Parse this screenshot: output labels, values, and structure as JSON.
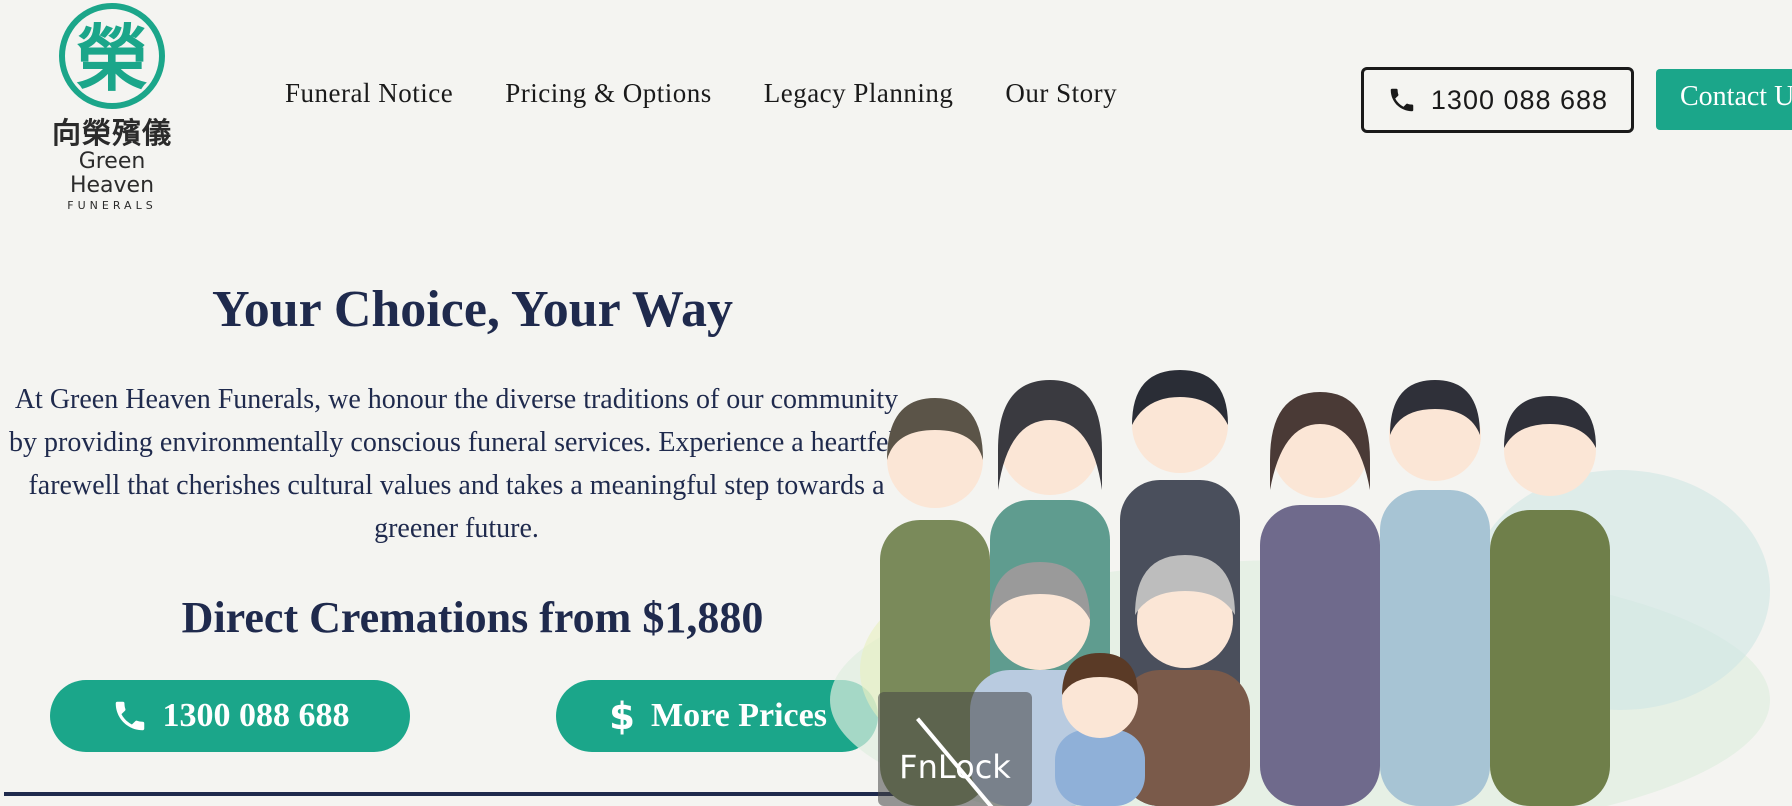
{
  "brand": {
    "name_cn": "向榮殯儀",
    "name_en": "Green Heaven",
    "subtitle": "FUNERALS",
    "logo_glyph": "榮",
    "accent": "#1ba68a",
    "navy": "#1f2a4d"
  },
  "nav": {
    "items": [
      {
        "label": "Funeral Notice"
      },
      {
        "label": "Pricing & Options"
      },
      {
        "label": "Legacy Planning"
      },
      {
        "label": "Our Story"
      }
    ]
  },
  "header": {
    "phone_label": "1300 088 688",
    "phone_icon": "phone-icon",
    "contact_label": "Contact U"
  },
  "hero": {
    "title": "Your Choice, Your Way",
    "text": "At Green Heaven Funerals, we honour the diverse traditions of our community by providing environmentally conscious funeral services. Experience a heartfelt farewell that cherishes cultural values and takes a meaningful step towards a greener future.",
    "cremation": "Direct Cremations from $1,880",
    "phone_button": "1300 088 688",
    "prices_button": "More Prices",
    "prices_icon": "dollar-icon"
  },
  "overlay": {
    "label": "FnLock"
  }
}
